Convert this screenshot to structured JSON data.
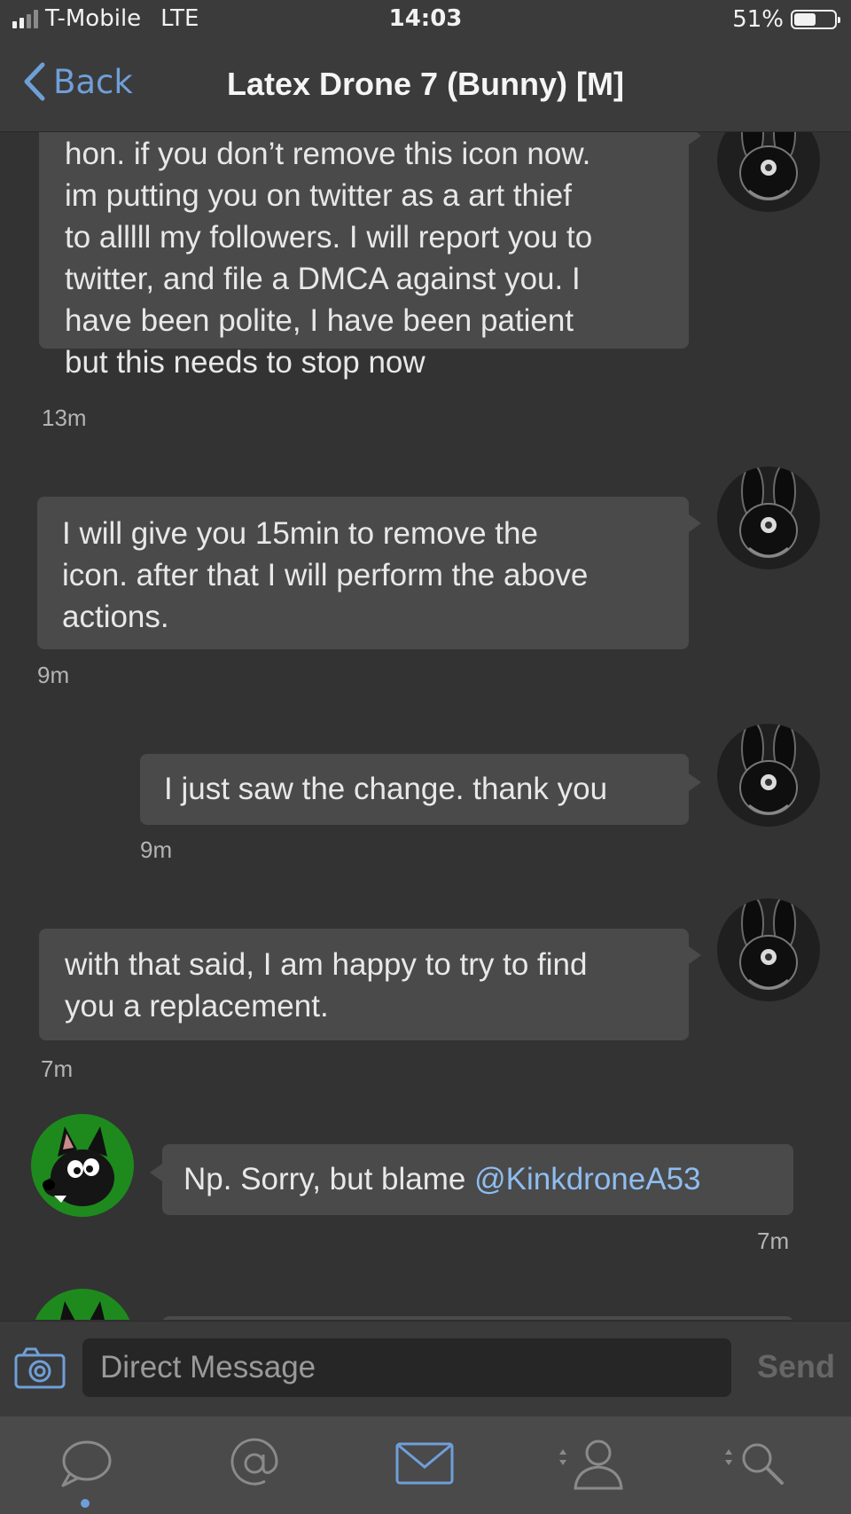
{
  "status_bar": {
    "carrier": "T-Mobile",
    "network": "LTE",
    "time": "14:03",
    "battery": "51%"
  },
  "nav": {
    "back_label": "Back",
    "title": "Latex Drone 7 (Bunny) [M]"
  },
  "messages": [
    {
      "sender": "other",
      "lines": [
        "hon. if you don’t remove this icon now.",
        "im putting you on twitter as a art thief",
        "to alllll my followers. I will report you to",
        "twitter, and file a DMCA against you. I",
        "have been polite, I have been patient",
        "but this needs to stop now"
      ],
      "time": "13m"
    },
    {
      "sender": "other",
      "lines": [
        "I will give you 15min to remove the",
        "icon. after that I will perform the above",
        "actions."
      ],
      "time": "9m"
    },
    {
      "sender": "other",
      "lines": [
        "I just saw the change. thank you"
      ],
      "time": "9m"
    },
    {
      "sender": "other",
      "lines": [
        "with that said, I am happy to try to find",
        "you a replacement."
      ],
      "time": "7m"
    },
    {
      "sender": "me",
      "text_prefix": "Np. Sorry, but blame ",
      "mention": "@KinkdroneA53",
      "time": "7m"
    }
  ],
  "composer": {
    "placeholder": "Direct Message",
    "send_label": "Send"
  },
  "tabs": [
    {
      "icon": "chat-bubble-icon",
      "active": true
    },
    {
      "icon": "at-sign-icon",
      "active": false
    },
    {
      "icon": "envelope-icon",
      "active": false
    },
    {
      "icon": "person-icon",
      "active": false
    },
    {
      "icon": "search-icon",
      "active": false
    }
  ],
  "colors": {
    "background": "#333333",
    "bubble": "#4a4a4a",
    "accent": "#6f9fd8",
    "mention": "#8fbdf0"
  }
}
